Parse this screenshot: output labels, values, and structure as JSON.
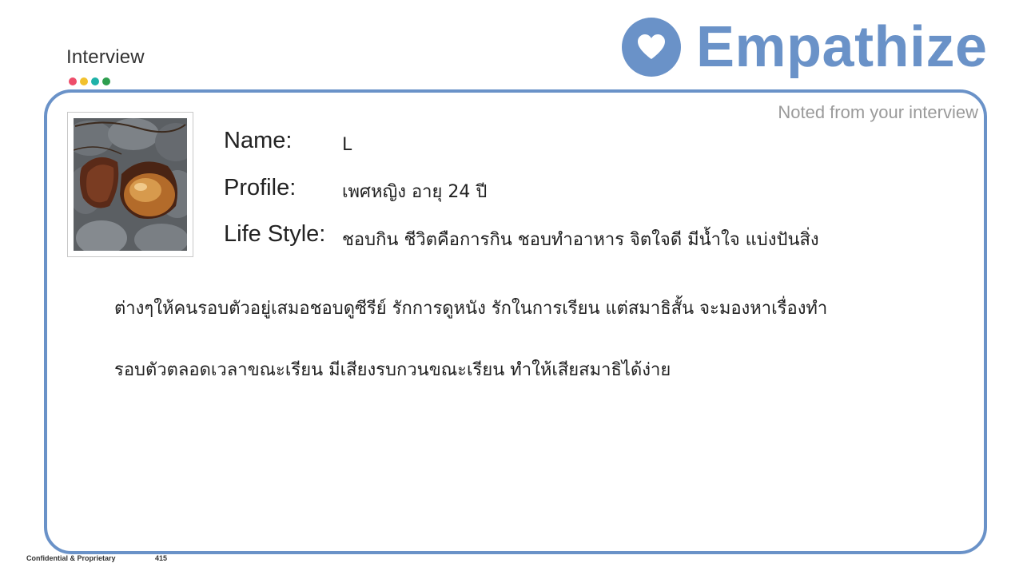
{
  "slide": {
    "section_title": "Interview",
    "dot_colors": [
      "#ee4d6a",
      "#f2c12e",
      "#1fb2a8",
      "#2e9e4e"
    ],
    "brand_title": "Empathize",
    "brand_color": "#6a92c8",
    "brand_icon": "heart-icon"
  },
  "card": {
    "note": "Noted from your interview",
    "photo_icon": "longan-seeds-photo",
    "fields": [
      {
        "label": "Name:",
        "value": "L"
      },
      {
        "label": "Profile:",
        "value": "เพศหญิง อายุ 24 ปี"
      },
      {
        "label": "Life Style:",
        "value": "ชอบกิน ชีวิตคือการกิน ชอบทำอาหาร จิตใจดี มีน้ำใจ แบ่งปันสิ่ง"
      }
    ],
    "body_lines": [
      "ต่างๆให้คนรอบตัวอยู่เสมอชอบดูซีรีย์ รักการดูหนัง รักในการเรียน แต่สมาธิสั้น จะมองหาเรื่องทำ",
      "รอบตัวตลอดเวลาขณะเรียน มีเสียงรบกวนขณะเรียน ทำให้เสียสมาธิได้ง่าย"
    ]
  },
  "footer": {
    "confidential": "Confidential & Proprietary",
    "page_number": "415"
  }
}
